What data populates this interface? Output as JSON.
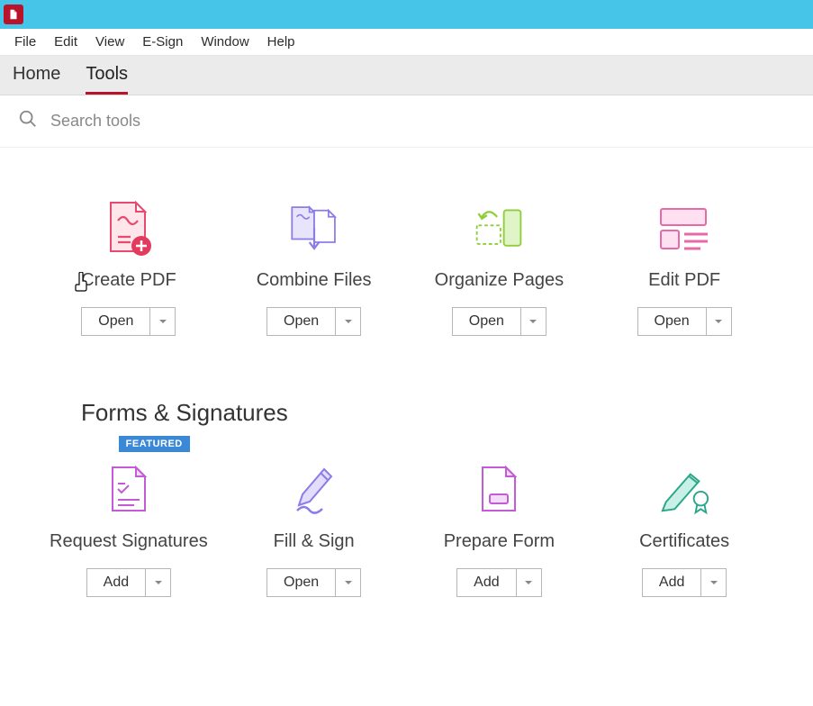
{
  "menubar": {
    "items": [
      "File",
      "Edit",
      "View",
      "E-Sign",
      "Window",
      "Help"
    ]
  },
  "tabs": {
    "home": "Home",
    "tools": "Tools"
  },
  "search": {
    "placeholder": "Search tools"
  },
  "row1": {
    "items": [
      {
        "label": "Create PDF",
        "button": "Open"
      },
      {
        "label": "Combine Files",
        "button": "Open"
      },
      {
        "label": "Organize Pages",
        "button": "Open"
      },
      {
        "label": "Edit PDF",
        "button": "Open"
      }
    ]
  },
  "section2": {
    "title": "Forms & Signatures"
  },
  "row2": {
    "items": [
      {
        "label": "Request Signatures",
        "button": "Add",
        "badge": "FEATURED"
      },
      {
        "label": "Fill & Sign",
        "button": "Open"
      },
      {
        "label": "Prepare Form",
        "button": "Add"
      },
      {
        "label": "Certificates",
        "button": "Add"
      }
    ]
  }
}
